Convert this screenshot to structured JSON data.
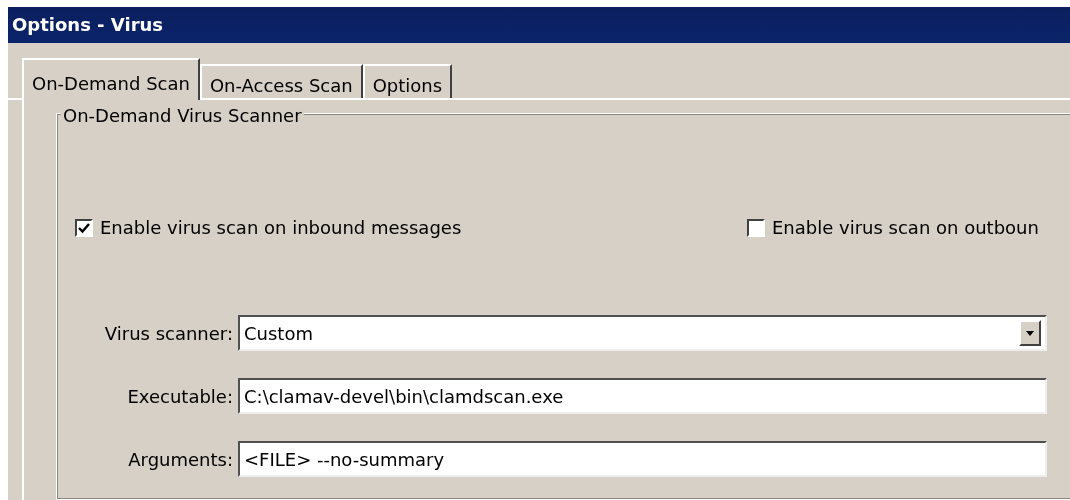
{
  "window": {
    "title": "Options - Virus"
  },
  "tabs": [
    {
      "label": "On-Demand Scan",
      "selected": true
    },
    {
      "label": "On-Access Scan",
      "selected": false
    },
    {
      "label": "Options",
      "selected": false
    }
  ],
  "group": {
    "title": "On-Demand Virus Scanner",
    "checkboxes": [
      {
        "label": "Enable virus scan on inbound messages",
        "checked": true
      },
      {
        "label": "Enable virus scan on outboun",
        "checked": false
      }
    ],
    "fields": [
      {
        "kind": "dropdown",
        "label": "Virus scanner:",
        "value": "Custom"
      },
      {
        "kind": "text",
        "label": "Executable:",
        "value": "C:\\clamav-devel\\bin\\clamdscan.exe"
      },
      {
        "kind": "text",
        "label": "Arguments:",
        "value": "<FILE> --no-summary"
      }
    ]
  }
}
